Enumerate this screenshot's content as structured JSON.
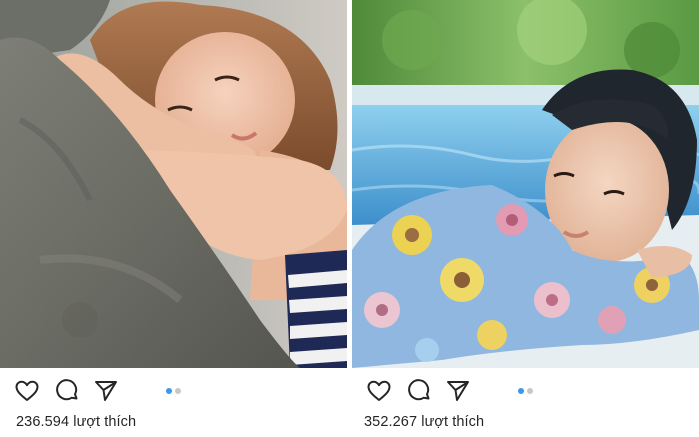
{
  "posts": [
    {
      "photo_icon": "photo-woman-resting-on-rock",
      "likes_text": "236.594 lượt thích",
      "carousel": {
        "count": 2,
        "active_index": 0
      },
      "icons": [
        "heart-icon",
        "comment-icon",
        "share-icon"
      ]
    },
    {
      "photo_icon": "photo-girl-resting-by-pool",
      "likes_text": "352.267 lượt thích",
      "carousel": {
        "count": 2,
        "active_index": 0
      },
      "icons": [
        "heart-icon",
        "comment-icon",
        "share-icon"
      ]
    }
  ],
  "colors": {
    "dot_active": "#3897f0",
    "dot_inactive": "#c7c7c7",
    "icon_stroke": "#262626"
  }
}
